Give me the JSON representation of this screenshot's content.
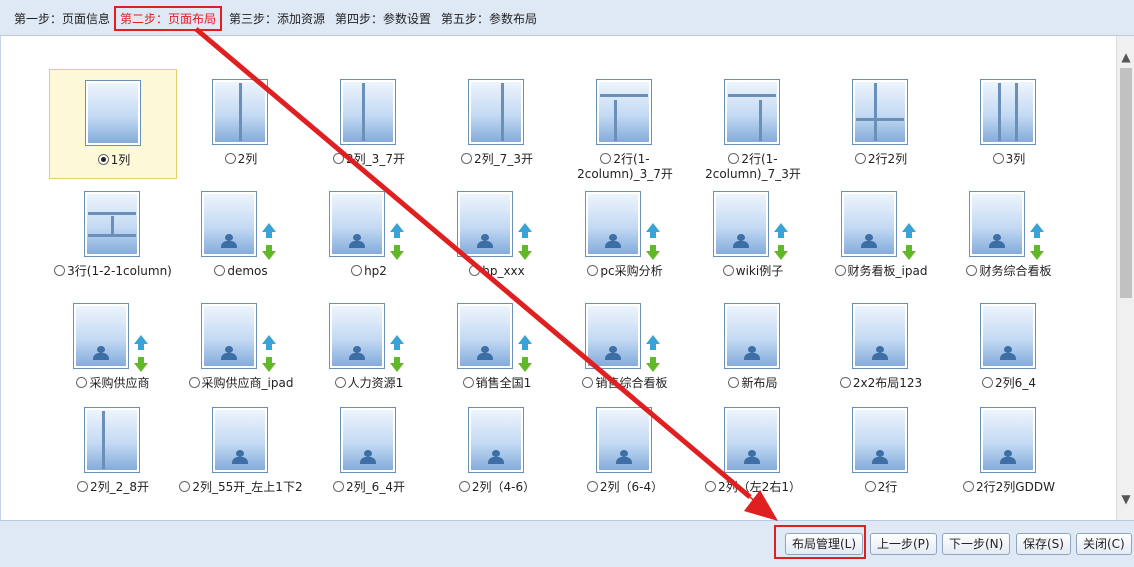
{
  "steps": [
    {
      "label": "第一步：页面信息",
      "active": false
    },
    {
      "label": "第二步：页面布局",
      "active": true
    },
    {
      "label": "第三步：添加资源",
      "active": false
    },
    {
      "label": "第四步：参数设置",
      "active": false
    },
    {
      "label": "第五步：参数布局",
      "active": false
    }
  ],
  "layouts": [
    {
      "label": "1列",
      "kind": "layout",
      "selected": true
    },
    {
      "label": "2列",
      "kind": "layout",
      "selected": false
    },
    {
      "label": "2列_3_7开",
      "kind": "layout",
      "selected": false
    },
    {
      "label": "2列_7_3开",
      "kind": "layout",
      "selected": false
    },
    {
      "label": "2行(1-2column)_3_7开",
      "kind": "layout",
      "selected": false
    },
    {
      "label": "2行(1-2column)_7_3开",
      "kind": "layout",
      "selected": false
    },
    {
      "label": "2行2列",
      "kind": "layout",
      "selected": false
    },
    {
      "label": "3列",
      "kind": "layout",
      "selected": false
    },
    {
      "label": "3行(1-2-1column)",
      "kind": "layout",
      "selected": false
    },
    {
      "label": "demos",
      "kind": "custom",
      "selected": false
    },
    {
      "label": "hp2",
      "kind": "custom",
      "selected": false
    },
    {
      "label": "hp_xxx",
      "kind": "custom",
      "selected": false
    },
    {
      "label": "pc采购分析",
      "kind": "custom",
      "selected": false
    },
    {
      "label": "wiki例子",
      "kind": "custom",
      "selected": false
    },
    {
      "label": "财务看板_ipad",
      "kind": "custom",
      "selected": false
    },
    {
      "label": "财务综合看板",
      "kind": "custom",
      "selected": false
    },
    {
      "label": "采购供应商",
      "kind": "custom",
      "selected": false
    },
    {
      "label": "采购供应商_ipad",
      "kind": "custom",
      "selected": false
    },
    {
      "label": "人力资源1",
      "kind": "custom",
      "selected": false
    },
    {
      "label": "销售全国1",
      "kind": "custom",
      "selected": false
    },
    {
      "label": "销售综合看板",
      "kind": "custom",
      "selected": false
    },
    {
      "label": "新布局",
      "kind": "plain",
      "selected": false
    },
    {
      "label": "2x2布局123",
      "kind": "plain",
      "selected": false
    },
    {
      "label": "2列6_4",
      "kind": "plain",
      "selected": false
    },
    {
      "label": "2列_2_8开",
      "kind": "layout",
      "selected": false
    },
    {
      "label": "2列_55开_左上1下2",
      "kind": "plain",
      "selected": false
    },
    {
      "label": "2列_6_4开",
      "kind": "plain",
      "selected": false
    },
    {
      "label": "2列（4-6）",
      "kind": "plain",
      "selected": false
    },
    {
      "label": "2列（6-4）",
      "kind": "plain",
      "selected": false
    },
    {
      "label": "2列（左2右1）",
      "kind": "plain",
      "selected": false
    },
    {
      "label": "2行",
      "kind": "plain",
      "selected": false
    },
    {
      "label": "2行2列GDDW",
      "kind": "plain",
      "selected": false
    }
  ],
  "footer": {
    "layout_manage": "布局管理(L)",
    "prev": "上一步(P)",
    "next": "下一步(N)",
    "save": "保存(S)",
    "close": "关闭(C)"
  },
  "colors": {
    "highlight": "#e02020",
    "bar_bg": "#dfe9f6",
    "thumb_border": "#6a8fb8"
  }
}
